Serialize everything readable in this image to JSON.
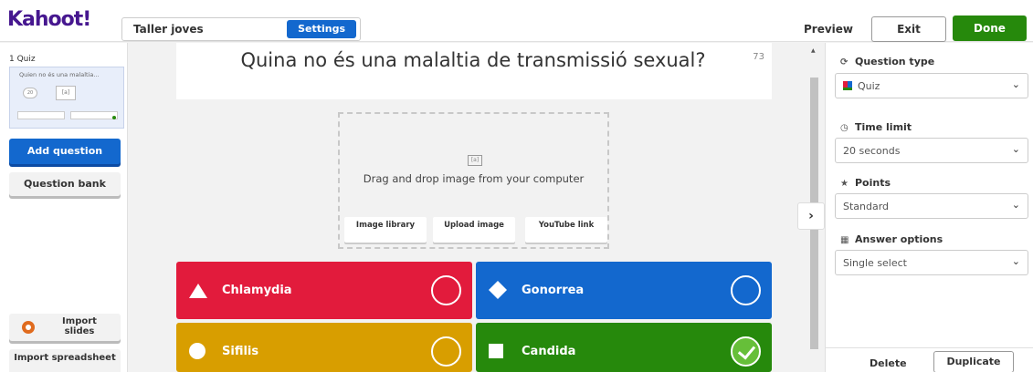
{
  "app": {
    "logo": "Kahoot!"
  },
  "header": {
    "title_value": "Taller joves",
    "settings_label": "Settings",
    "preview_label": "Preview",
    "exit_label": "Exit",
    "done_label": "Done"
  },
  "sidebar": {
    "slide_label": "1  Quiz",
    "slide_question": "Quien no és una malaltia...",
    "slide_time": "20",
    "slide_image": "[a]",
    "add_question": "Add question",
    "question_bank": "Question bank",
    "import_slides": "Import slides",
    "import_spreadsheet": "Import spreadsheet"
  },
  "question": {
    "text": "Quina no és una malaltia de transmissió sexual?",
    "char_count": "73"
  },
  "media": {
    "prompt": "Drag and drop image from your computer",
    "icon_glyph": "[a]",
    "image_library": "Image library",
    "upload_image": "Upload image",
    "youtube_link": "YouTube link"
  },
  "answers": [
    {
      "text": "Chlamydia",
      "shape": "triangle",
      "color": "#e21b3c",
      "correct": false
    },
    {
      "text": "Gonorrea",
      "shape": "diamond",
      "color": "#1368ce",
      "correct": false
    },
    {
      "text": "Sifilis",
      "shape": "circle",
      "color": "#d89e00",
      "correct": false
    },
    {
      "text": "Candida",
      "shape": "square",
      "color": "#26890c",
      "correct": true
    }
  ],
  "settings_panel": {
    "question_type_label": "Question type",
    "question_type_value": "Quiz",
    "time_limit_label": "Time limit",
    "time_limit_value": "20 seconds",
    "points_label": "Points",
    "points_value": "Standard",
    "answer_options_label": "Answer options",
    "answer_options_value": "Single select",
    "delete_label": "Delete",
    "duplicate_label": "Duplicate"
  },
  "colors": {
    "brand": "#46178f",
    "primary": "#1368ce",
    "done": "#26890c"
  }
}
